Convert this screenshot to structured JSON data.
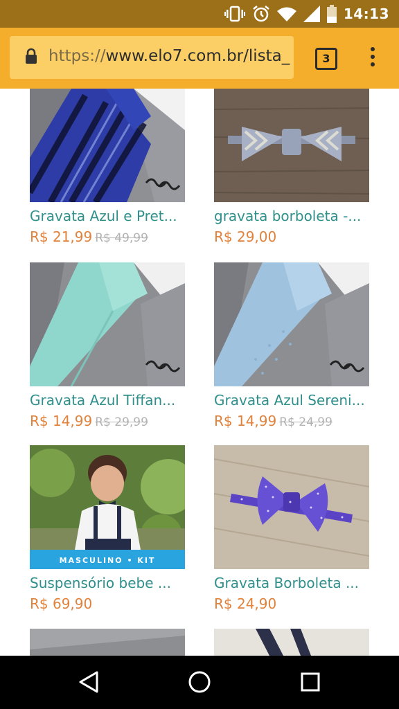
{
  "status_bar": {
    "time": "14:13"
  },
  "browser": {
    "url_scheme": "https://",
    "url_host": "www.elo7.com.br/lista_",
    "tab_count": "3"
  },
  "products": [
    {
      "title": "Gravata Azul e Pret...",
      "price": "R$ 21,99",
      "old_price": "R$ 49,99"
    },
    {
      "title": "gravata borboleta -...",
      "price": "R$ 29,00",
      "old_price": ""
    },
    {
      "title": "Gravata Azul Tiffan...",
      "price": "R$ 14,99",
      "old_price": "R$ 29,99"
    },
    {
      "title": "Gravata Azul Sereni...",
      "price": "R$ 14,99",
      "old_price": "R$ 24,99"
    },
    {
      "title": "Suspensório bebe ...",
      "price": "R$ 69,90",
      "old_price": "",
      "banner": "MASCULINO • KIT"
    },
    {
      "title": "Gravata Borboleta ...",
      "price": "R$ 24,90",
      "old_price": ""
    }
  ],
  "nav": {
    "back_icon": "back-triangle-icon",
    "home_icon": "home-circle-icon",
    "recents_icon": "recents-square-icon"
  }
}
